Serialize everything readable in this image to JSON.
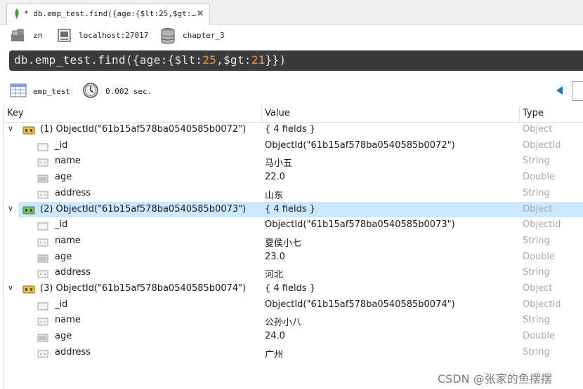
{
  "tab": {
    "title": "* db.emp_test.find({age:{$lt:25,$gt:…"
  },
  "connection": {
    "user": "zn",
    "host": "localhost:27017",
    "database": "chapter_3"
  },
  "query": {
    "segments": [
      {
        "text": "db.emp_test.find({age:{$lt:",
        "color": "#e6e6e6"
      },
      {
        "text": "25",
        "color": "#e89a4b"
      },
      {
        "text": ",$gt:",
        "color": "#e6e6e6"
      },
      {
        "text": "21",
        "color": "#e89a4b"
      },
      {
        "text": "}})",
        "color": "#e6e6e6"
      }
    ]
  },
  "result": {
    "collection": "emp_test",
    "time": "0.002 sec."
  },
  "columns": {
    "key": "Key",
    "value": "Value",
    "type": "Type"
  },
  "documents": [
    {
      "key": "(1) ObjectId(\"61b15af578ba0540585b0072\")",
      "value": "{ 4 fields }",
      "type": "Object",
      "selected": false,
      "fields": [
        {
          "key": "_id",
          "value": "ObjectId(\"61b15af578ba0540585b0072\")",
          "type": "ObjectId",
          "icon": "id-icon"
        },
        {
          "key": "name",
          "value": "马小五",
          "type": "String",
          "icon": "string-icon"
        },
        {
          "key": "age",
          "value": "22.0",
          "type": "Double",
          "icon": "number-icon"
        },
        {
          "key": "address",
          "value": "山东",
          "type": "String",
          "icon": "string-icon"
        }
      ]
    },
    {
      "key": "(2) ObjectId(\"61b15af578ba0540585b0073\")",
      "value": "{ 4 fields }",
      "type": "Object",
      "selected": true,
      "fields": [
        {
          "key": "_id",
          "value": "ObjectId(\"61b15af578ba0540585b0073\")",
          "type": "ObjectId",
          "icon": "id-icon"
        },
        {
          "key": "name",
          "value": "夏侯小七",
          "type": "String",
          "icon": "string-icon"
        },
        {
          "key": "age",
          "value": "23.0",
          "type": "Double",
          "icon": "number-icon"
        },
        {
          "key": "address",
          "value": "河北",
          "type": "String",
          "icon": "string-icon"
        }
      ]
    },
    {
      "key": "(3) ObjectId(\"61b15af578ba0540585b0074\")",
      "value": "{ 4 fields }",
      "type": "Object",
      "selected": false,
      "fields": [
        {
          "key": "_id",
          "value": "ObjectId(\"61b15af578ba0540585b0074\")",
          "type": "ObjectId",
          "icon": "id-icon"
        },
        {
          "key": "name",
          "value": "公孙小八",
          "type": "String",
          "icon": "string-icon"
        },
        {
          "key": "age",
          "value": "24.0",
          "type": "Double",
          "icon": "number-icon"
        },
        {
          "key": "address",
          "value": "广州",
          "type": "String",
          "icon": "string-icon"
        }
      ]
    }
  ],
  "watermark": "CSDN @张家的鱼摆摆"
}
